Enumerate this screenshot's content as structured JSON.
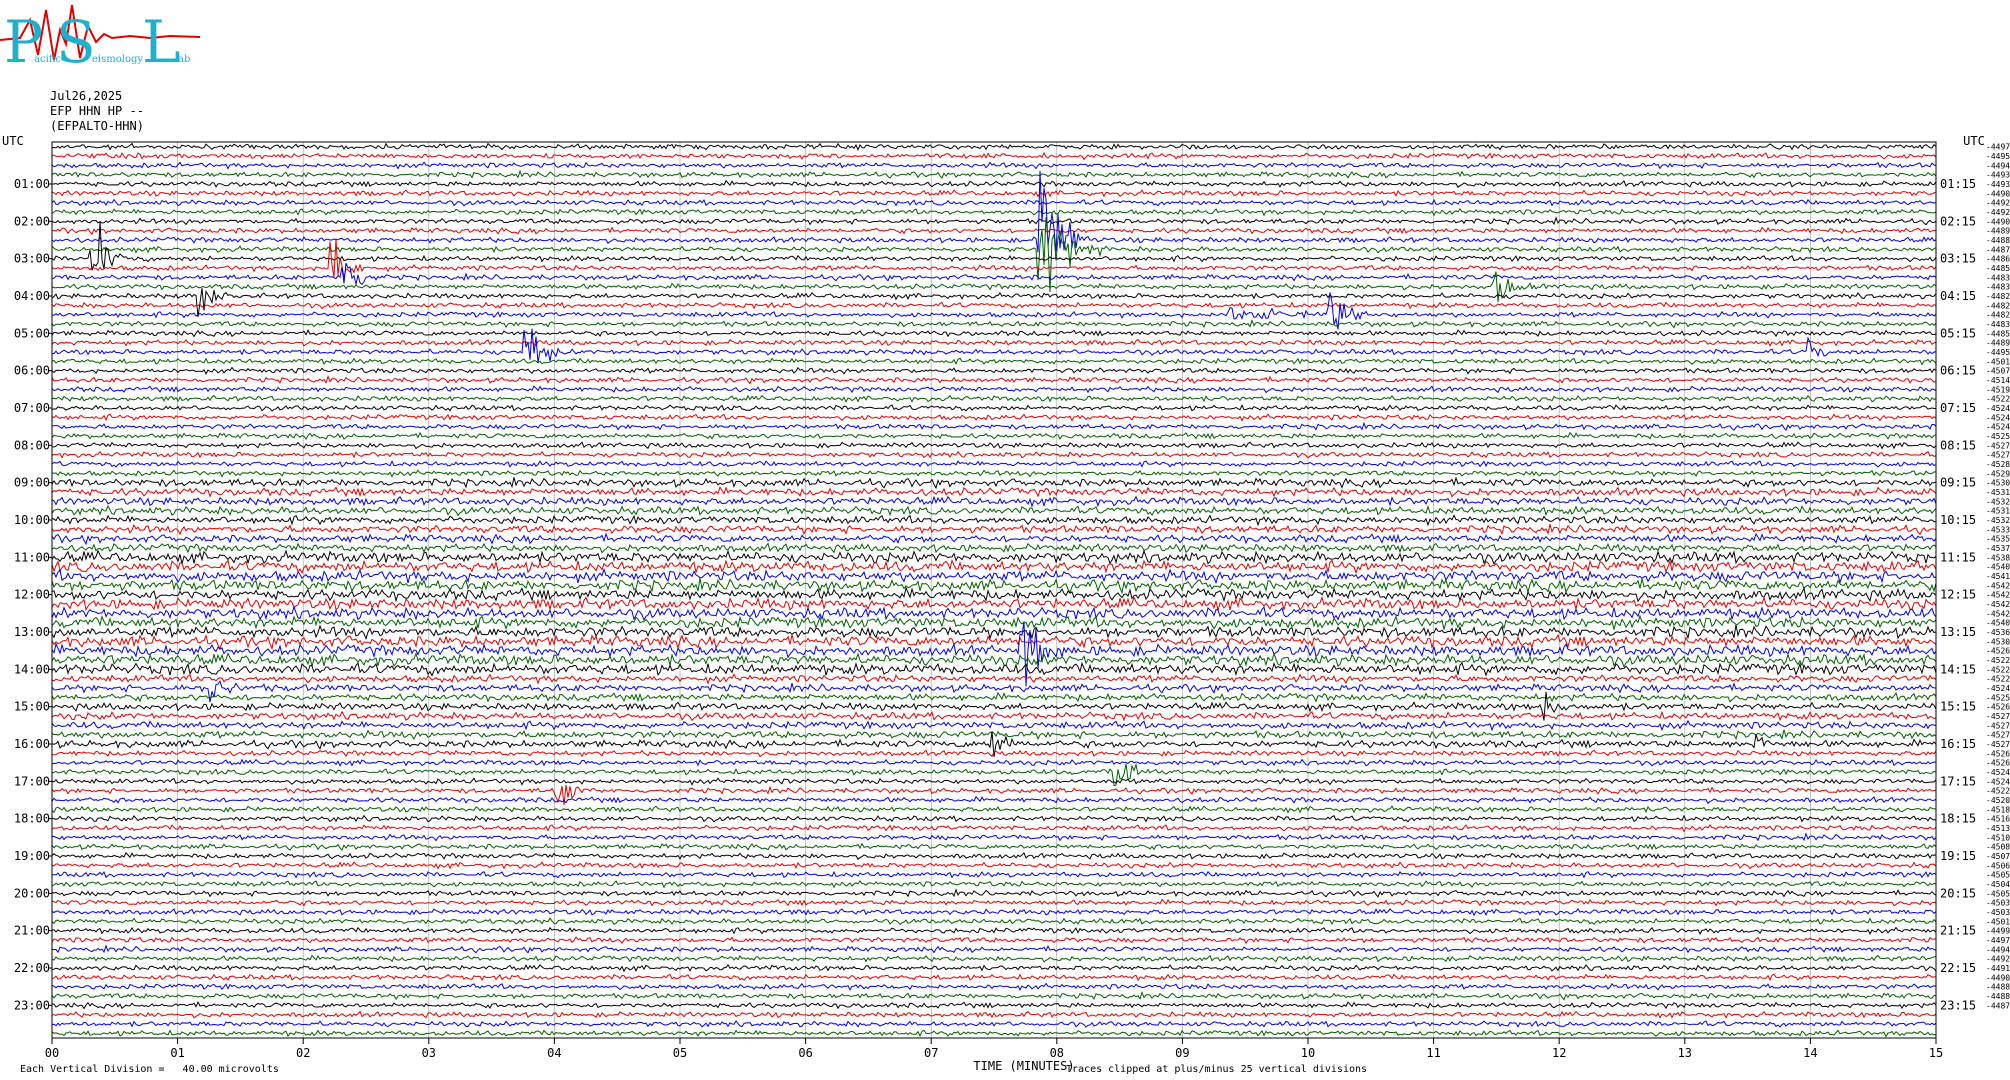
{
  "header": {
    "date": "Jul26,2025",
    "channel": "EFP HHN HP --",
    "station_code": "(EFPALTO-HHN)",
    "logo_letters": [
      "P",
      "S",
      "L"
    ],
    "logo_words": [
      "acific",
      "eismology",
      "ab"
    ]
  },
  "footer": {
    "scale_note": "Each Vertical Division =   40.00 microvolts",
    "clip_note": "Traces clipped at plus/minus 25 vertical divisions"
  },
  "chart_data": {
    "type": "line",
    "title": "",
    "xlabel": "TIME (MINUTES)",
    "ylabel_left": "UTC",
    "ylabel_right": "UTC",
    "x_ticks": [
      "00",
      "01",
      "02",
      "03",
      "04",
      "05",
      "06",
      "07",
      "08",
      "09",
      "10",
      "11",
      "12",
      "13",
      "14",
      "15"
    ],
    "xlim": [
      0,
      15
    ],
    "left_hour_labels": [
      "01:00",
      "02:00",
      "03:00",
      "04:00",
      "05:00",
      "06:00",
      "07:00",
      "08:00",
      "09:00",
      "10:00",
      "11:00",
      "12:00",
      "13:00",
      "14:00",
      "15:00",
      "16:00",
      "17:00",
      "18:00",
      "19:00",
      "20:00",
      "21:00",
      "22:00",
      "23:00"
    ],
    "right_hour_labels": [
      "01:15",
      "02:15",
      "03:15",
      "04:15",
      "05:15",
      "06:15",
      "07:15",
      "08:15",
      "09:15",
      "10:15",
      "11:15",
      "12:15",
      "13:15",
      "14:15",
      "15:15",
      "16:15",
      "17:15",
      "18:15",
      "19:15",
      "20:15",
      "21:15",
      "22:15",
      "23:15"
    ],
    "trace_count": 96,
    "trace_interval_minutes": 15,
    "trace_color_cycle": [
      "#000000",
      "#e00000",
      "#0000e0",
      "#006000"
    ],
    "right_trace_offsets": [
      "-44978",
      "-44953",
      "-44944",
      "-44934",
      "-44931",
      "-44908",
      "-44923",
      "-44922",
      "-44908",
      "-44895",
      "-44889",
      "-44873",
      "-44865",
      "-44855",
      "-44837",
      "-44835",
      "-44823",
      "-44824",
      "-44825",
      "-44832",
      "-44858",
      "-44894",
      "-44953",
      "-45018",
      "-45078",
      "-45143",
      "-45195",
      "-45226",
      "-45242",
      "-45242",
      "-45246",
      "-45255",
      "-45270",
      "-45274",
      "-45284",
      "-45293",
      "-45304",
      "-45317",
      "-45326",
      "-45318",
      "-45323",
      "-45335",
      "-45353",
      "-45372",
      "-45384",
      "-45401",
      "-45415",
      "-45421",
      "-45424",
      "-45424",
      "-45424",
      "-45408",
      "-45361",
      "-45309",
      "-45265",
      "-45227",
      "-45223",
      "-45227",
      "-45242",
      "-45256",
      "-45262",
      "-45271",
      "-45277",
      "-45276",
      "-45273",
      "-45266",
      "-45262",
      "-45249",
      "-45241",
      "-45224",
      "-45205",
      "-45182",
      "-45162",
      "-45138",
      "-45104",
      "-45085",
      "-45072",
      "-45061",
      "-45050",
      "-45044",
      "-45056",
      "-45038",
      "-45038",
      "-45016",
      "-44996",
      "-44977",
      "-44944",
      "-44924",
      "-44916",
      "-44904",
      "-44888",
      "-44880",
      "-44871"
    ],
    "grid": true
  }
}
